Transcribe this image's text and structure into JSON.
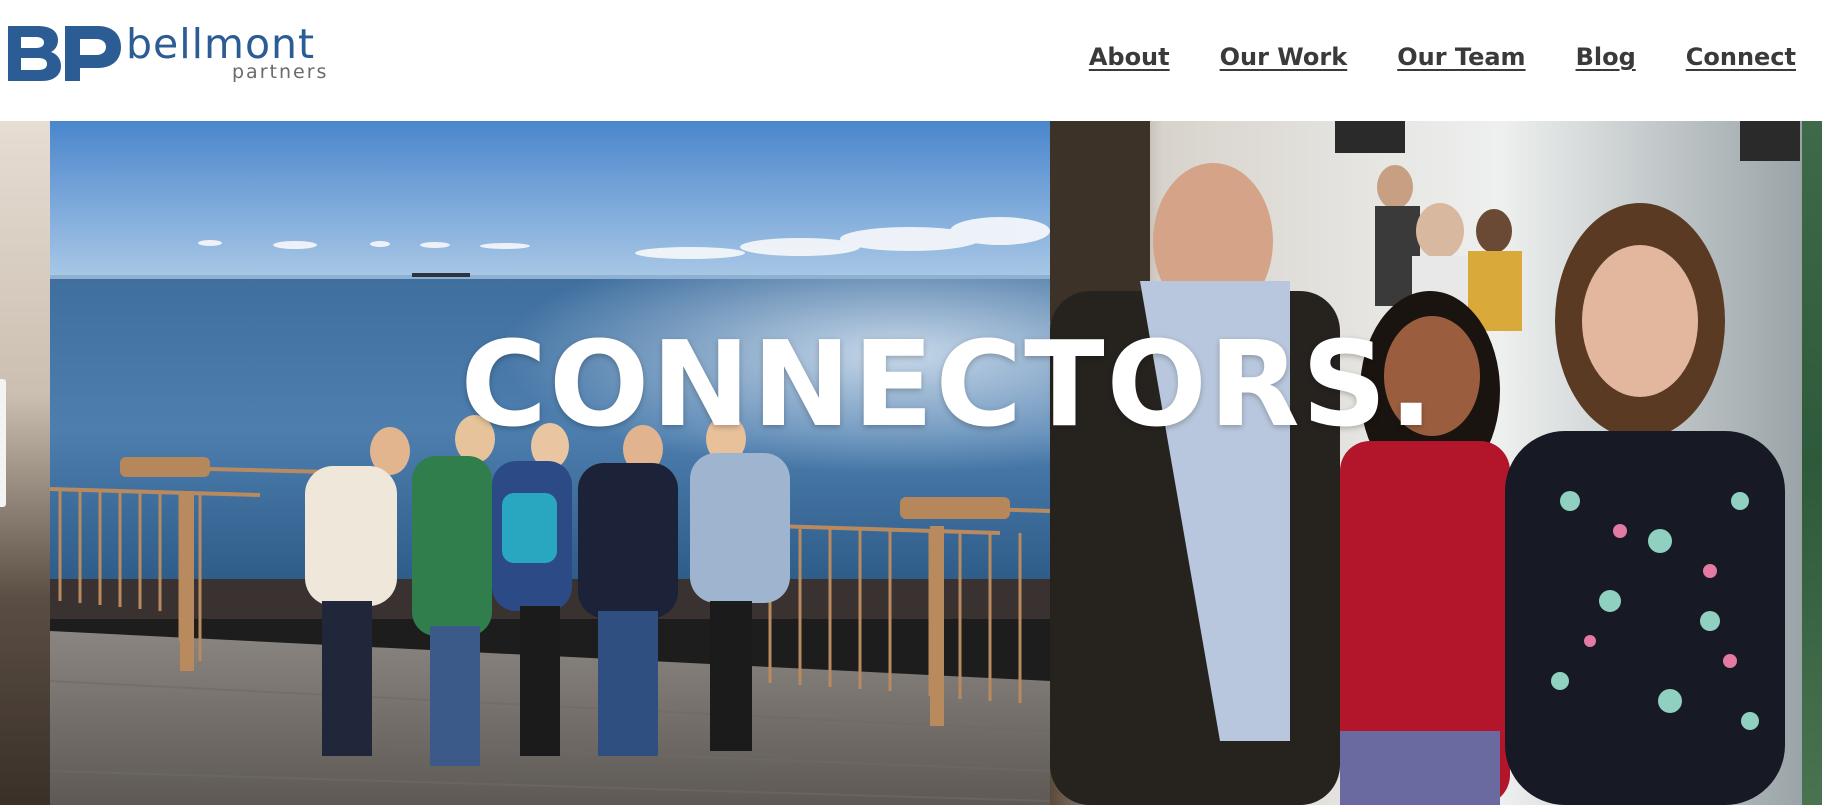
{
  "brand": {
    "name": "bellmont",
    "subtitle": "partners",
    "mark": "BP",
    "color": "#2b5c93"
  },
  "nav": {
    "items": [
      {
        "label": "About"
      },
      {
        "label": "Our Work"
      },
      {
        "label": "Our Team"
      },
      {
        "label": "Blog"
      },
      {
        "label": "Connect"
      }
    ],
    "color": "#3a3a3a"
  },
  "hero": {
    "headline": "CONNECTORS.",
    "slides": [
      {
        "alt": "Five women posing on a lakeside overlook with a railing"
      },
      {
        "alt": "Three people posing together at an indoor event"
      }
    ]
  },
  "icons": {
    "prev": "slider-prev-handle"
  }
}
